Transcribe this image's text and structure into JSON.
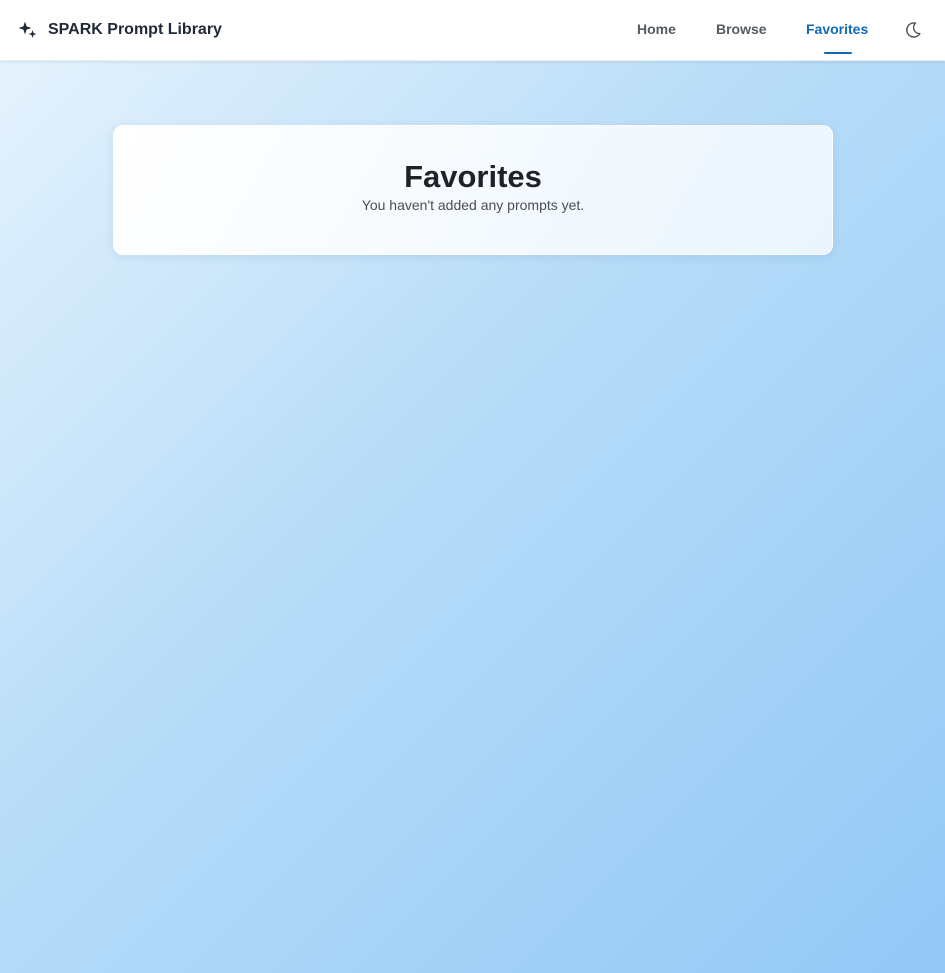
{
  "header": {
    "brand_name": "SPARK Prompt Library",
    "brand_icon": "sparkles-icon",
    "nav": {
      "home": "Home",
      "browse": "Browse",
      "favorites": "Favorites"
    },
    "active_nav": "favorites",
    "theme_toggle_icon": "moon-icon"
  },
  "main": {
    "title": "Favorites",
    "empty_message": "You haven't added any prompts yet."
  },
  "colors": {
    "accent": "#1269b5",
    "background_start": "#e8f4fd",
    "background_end": "#92c8f6"
  }
}
